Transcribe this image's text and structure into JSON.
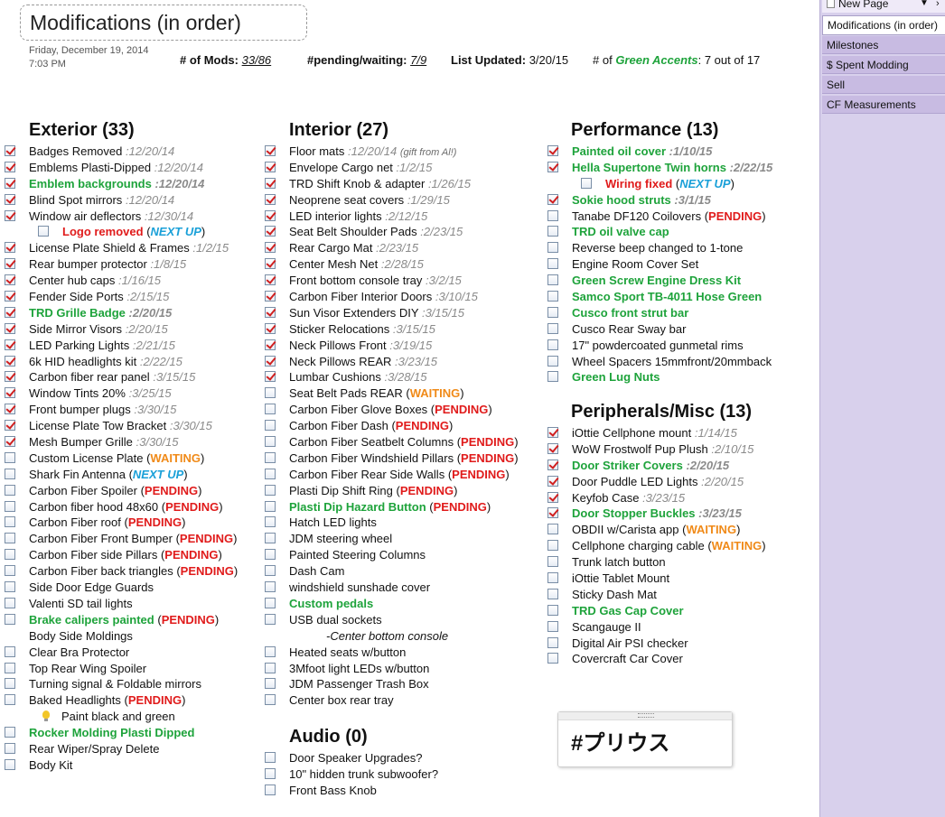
{
  "page": {
    "title": "Modifications (in order)",
    "date": "Friday, December 19, 2014",
    "time": "7:03 PM"
  },
  "stats": {
    "mods_label": "# of Mods:",
    "mods_value": "33/86",
    "pending_label": "#pending/waiting:",
    "pending_value": "7/9",
    "updated_label": "List Updated:",
    "updated_value": "3/20/15",
    "accents_label_prefix": "# of",
    "accents_label_green": "Green Accents",
    "accents_label_suffix": ":",
    "accents_value": "7 out of 17"
  },
  "sections": {
    "exterior": {
      "title": "Exterior (33)",
      "items": [
        {
          "text": "Badges Removed",
          "date": ":12/20/14",
          "checked": true
        },
        {
          "text": "Emblems Plasti-Dipped",
          "date": ":12/20/14",
          "checked": true
        },
        {
          "text": "Emblem backgrounds",
          "date": ":12/20/14",
          "checked": true,
          "style": "green"
        },
        {
          "text": "Blind Spot mirrors",
          "date": ":12/20/14",
          "checked": true
        },
        {
          "text": "Window air deflectors",
          "date": ":12/30/14",
          "checked": true
        },
        {
          "text": "Logo removed",
          "status": "NEXT UP",
          "checked": false,
          "indent": true,
          "style": "red"
        },
        {
          "text": "License Plate Shield & Frames",
          "date": ":1/2/15",
          "checked": true
        },
        {
          "text": "Rear bumper protector",
          "date": ":1/8/15",
          "checked": true
        },
        {
          "text": "Center hub caps",
          "date": ":1/16/15",
          "checked": true
        },
        {
          "text": "Fender Side Ports",
          "date": ":2/15/15",
          "checked": true
        },
        {
          "text": "TRD Grille Badge",
          "date": ":2/20/15",
          "checked": true,
          "style": "green"
        },
        {
          "text": "Side Mirror Visors",
          "date": ":2/20/15",
          "checked": true
        },
        {
          "text": "LED Parking Lights",
          "date": ":2/21/15",
          "checked": true
        },
        {
          "text": "6k HID headlights kit",
          "date": ":2/22/15",
          "checked": true
        },
        {
          "text": "Carbon fiber rear panel",
          "date": ":3/15/15",
          "checked": true
        },
        {
          "text": "Window Tints 20%",
          "date": ":3/25/15",
          "checked": true
        },
        {
          "text": "Front bumper plugs",
          "date": ":3/30/15",
          "checked": true
        },
        {
          "text": "License Plate Tow Bracket",
          "date": ":3/30/15",
          "checked": true
        },
        {
          "text": "Mesh Bumper Grille",
          "date": ":3/30/15",
          "checked": true
        },
        {
          "text": "Custom License Plate",
          "status": "WAITING",
          "checked": false
        },
        {
          "text": "Shark Fin Antenna",
          "status": "NEXT UP",
          "checked": false
        },
        {
          "text": "Carbon Fiber  Spoiler",
          "status": "PENDING",
          "checked": false
        },
        {
          "text": "Carbon fiber hood 48x60",
          "status": "PENDING",
          "checked": false
        },
        {
          "text": "Carbon Fiber roof",
          "status": "PENDING",
          "checked": false
        },
        {
          "text": "Carbon Fiber Front Bumper",
          "status": "PENDING",
          "checked": false
        },
        {
          "text": "Carbon Fiber side Pillars",
          "status": "PENDING",
          "checked": false
        },
        {
          "text": "Carbon Fiber back triangles",
          "status": "PENDING",
          "checked": false
        },
        {
          "text": "Side Door Edge Guards",
          "checked": false
        },
        {
          "text": "Valenti SD tail lights",
          "checked": false
        },
        {
          "text": "Brake calipers painted",
          "status": "PENDING",
          "checked": false,
          "style": "green"
        },
        {
          "text": "Body Side Moldings",
          "nocheck": true
        },
        {
          "text": "Clear Bra Protector",
          "checked": false
        },
        {
          "text": "Top Rear Wing Spoiler",
          "checked": false
        },
        {
          "text": "Turning signal & Foldable mirrors",
          "checked": false
        },
        {
          "text": "Baked Headlights",
          "status": "PENDING",
          "checked": false
        },
        {
          "text": "Paint black and green",
          "bulb": true
        },
        {
          "text": "Rocker Molding Plasti Dipped",
          "checked": false,
          "style": "green"
        },
        {
          "text": "Rear Wiper/Spray Delete",
          "checked": false
        },
        {
          "text": "Body Kit",
          "checked": false
        }
      ]
    },
    "interior": {
      "title": "Interior (27)",
      "items": [
        {
          "text": "Floor mats",
          "date": ":12/20/14",
          "note": "(gift from Al!)",
          "checked": true
        },
        {
          "text": "Envelope Cargo net",
          "date": ":1/2/15",
          "checked": true
        },
        {
          "text": "TRD Shift Knob & adapter",
          "date": ":1/26/15",
          "checked": true
        },
        {
          "text": "Neoprene seat covers",
          "date": ":1/29/15",
          "checked": true
        },
        {
          "text": "LED interior lights",
          "date": ":2/12/15",
          "checked": true
        },
        {
          "text": "Seat Belt Shoulder Pads",
          "date": ":2/23/15",
          "checked": true
        },
        {
          "text": "Rear Cargo Mat",
          "date": ":2/23/15",
          "checked": true
        },
        {
          "text": "Center Mesh Net",
          "date": ":2/28/15",
          "checked": true
        },
        {
          "text": "Front bottom console tray",
          "date": ":3/2/15",
          "checked": true
        },
        {
          "text": "Carbon Fiber Interior Doors",
          "date": ":3/10/15",
          "checked": true
        },
        {
          "text": "Sun Visor Extenders DIY",
          "date": ":3/15/15",
          "checked": true
        },
        {
          "text": "Sticker Relocations",
          "date": ":3/15/15",
          "checked": true
        },
        {
          "text": "Neck Pillows Front",
          "date": ":3/19/15",
          "checked": true
        },
        {
          "text": "Neck Pillows REAR",
          "date": ":3/23/15",
          "checked": true
        },
        {
          "text": "Lumbar Cushions",
          "date": ":3/28/15",
          "checked": true
        },
        {
          "text": "Seat Belt Pads REAR",
          "status": "WAITING",
          "checked": false
        },
        {
          "text": "Carbon Fiber Glove Boxes",
          "status": "PENDING",
          "checked": false
        },
        {
          "text": "Carbon Fiber Dash",
          "status": "PENDING",
          "checked": false
        },
        {
          "text": "Carbon Fiber Seatbelt Columns",
          "status": "PENDING",
          "checked": false
        },
        {
          "text": "Carbon Fiber Windshield Pillars",
          "status": "PENDING",
          "checked": false
        },
        {
          "text": "Carbon Fiber Rear Side Walls",
          "status": "PENDING",
          "checked": false
        },
        {
          "text": "Plasti Dip Shift Ring",
          "status": "PENDING",
          "checked": false
        },
        {
          "text": "Plasti Dip Hazard Button",
          "status": "PENDING",
          "checked": false,
          "style": "green"
        },
        {
          "text": "Hatch LED lights",
          "checked": false
        },
        {
          "text": "JDM steering wheel",
          "checked": false
        },
        {
          "text": "Painted Steering Columns",
          "checked": false
        },
        {
          "text": "Dash Cam",
          "checked": false
        },
        {
          "text": " windshield sunshade cover",
          "checked": false
        },
        {
          "text": "Custom pedals",
          "checked": false,
          "style": "green"
        },
        {
          "text": "USB dual sockets",
          "checked": false
        },
        {
          "text": "-Center bottom console",
          "nocheck": true,
          "style": "italic",
          "indent": true
        },
        {
          "text": "Heated seats w/button",
          "checked": false
        },
        {
          "text": "3Mfoot light LEDs w/button",
          "checked": false
        },
        {
          "text": "JDM Passenger Trash Box",
          "checked": false
        },
        {
          "text": "Center box rear tray",
          "checked": false
        }
      ]
    },
    "audio": {
      "title": "Audio (0)",
      "items": [
        {
          "text": "Door Speaker Upgrades?",
          "checked": false
        },
        {
          "text": "10\" hidden trunk subwoofer?",
          "checked": false
        },
        {
          "text": "Front Bass Knob",
          "checked": false
        }
      ]
    },
    "performance": {
      "title": "Performance (13)",
      "items": [
        {
          "text": "Painted oil cover",
          "date": ":1/10/15",
          "checked": true,
          "style": "green"
        },
        {
          "text": "Hella Supertone Twin horns",
          "date": ":2/22/15",
          "checked": true,
          "style": "green"
        },
        {
          "text": "Wiring fixed",
          "status": "NEXT UP",
          "checked": false,
          "indent": true,
          "style": "red"
        },
        {
          "text": "Sokie hood struts",
          "date": ":3/1/15",
          "checked": true,
          "style": "green"
        },
        {
          "text": "Tanabe DF120  Coilovers",
          "status": "PENDING",
          "checked": false
        },
        {
          "text": "TRD oil valve cap",
          "checked": false,
          "style": "green"
        },
        {
          "text": "Reverse beep changed to 1-tone",
          "checked": false
        },
        {
          "text": "Engine Room Cover Set",
          "checked": false
        },
        {
          "text": "Green Screw Engine Dress Kit",
          "checked": false,
          "style": "green"
        },
        {
          "text": "Samco Sport TB-4011  Hose Green",
          "checked": false,
          "style": "green"
        },
        {
          "text": "Cusco front strut bar",
          "checked": false,
          "style": "green"
        },
        {
          "text": "Cusco Rear Sway bar",
          "checked": false
        },
        {
          "text": "17\" powdercoated gunmetal rims",
          "checked": false
        },
        {
          "text": "Wheel Spacers 15mmfront/20mmback",
          "checked": false
        },
        {
          "text": "Green Lug Nuts",
          "checked": false,
          "style": "green"
        }
      ]
    },
    "peripherals": {
      "title": "Peripherals/Misc (13)",
      "items": [
        {
          "text": "iOttie Cellphone  mount",
          "date": ":1/14/15",
          "checked": true
        },
        {
          "text": "WoW Frostwolf Pup Plush",
          "date": ":2/10/15",
          "checked": true
        },
        {
          "text": "Door Striker Covers",
          "date": ":2/20/15",
          "checked": true,
          "style": "green"
        },
        {
          "text": "Door Puddle LED Lights",
          "date": ":2/20/15",
          "checked": true
        },
        {
          "text": "Keyfob Case",
          "date": ":3/23/15",
          "checked": true
        },
        {
          "text": "Door Stopper Buckles",
          "date": ":3/23/15",
          "checked": true,
          "style": "green"
        },
        {
          "text": "OBDII w/Carista app",
          "status": "WAITING",
          "checked": false
        },
        {
          "text": "Cellphone charging cable",
          "status": "WAITING",
          "checked": false
        },
        {
          "text": "Trunk latch button",
          "checked": false
        },
        {
          "text": "iOttie Tablet Mount",
          "checked": false
        },
        {
          "text": "Sticky Dash Mat",
          "checked": false
        },
        {
          "text": "TRD Gas Cap Cover",
          "checked": false,
          "style": "green"
        },
        {
          "text": "Scangauge II",
          "checked": false
        },
        {
          "text": "Digital Air PSI checker",
          "checked": false
        },
        {
          "text": "Covercraft Car Cover",
          "checked": false
        }
      ]
    }
  },
  "tag_note": {
    "text": "#プリウス"
  },
  "sidebar": {
    "new_page": "New Page",
    "pages": [
      {
        "label": "Modifications (in order)",
        "active": true
      },
      {
        "label": "Milestones",
        "active": false
      },
      {
        "label": "$ Spent Modding",
        "active": false
      },
      {
        "label": "Sell",
        "active": false
      },
      {
        "label": "CF Measurements",
        "active": false
      }
    ]
  }
}
